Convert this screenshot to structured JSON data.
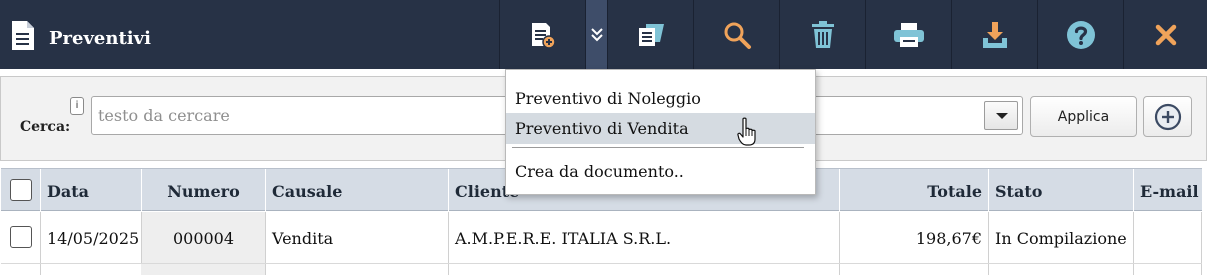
{
  "header": {
    "title": "Preventivi",
    "icon": "document-icon"
  },
  "toolbar": {
    "buttons": [
      {
        "name": "new-quote-button",
        "icon": "new-document-plus-icon"
      },
      {
        "name": "new-options-toggle",
        "icon": "double-chevron-down-icon"
      },
      {
        "name": "copy-button",
        "icon": "copy-documents-icon"
      },
      {
        "name": "search-button",
        "icon": "magnifier-icon"
      },
      {
        "name": "delete-button",
        "icon": "trash-icon"
      },
      {
        "name": "print-button",
        "icon": "printer-icon"
      },
      {
        "name": "download-button",
        "icon": "download-icon"
      },
      {
        "name": "help-button",
        "icon": "question-icon"
      },
      {
        "name": "close-button",
        "icon": "close-x-icon"
      }
    ],
    "icon_color": "#f0a35a",
    "help_icon_color": "#7fc3d6"
  },
  "search": {
    "info_badge": "i",
    "label": "Cerca:",
    "placeholder": "testo da cercare",
    "value": "",
    "apply_label": "Applica"
  },
  "menu": {
    "items": [
      "Preventivo di Noleggio",
      "Preventivo di Vendita",
      "Crea da documento.."
    ],
    "hovered_index": 1
  },
  "table": {
    "columns": [
      "",
      "Data",
      "Numero",
      "Causale",
      "Cliente",
      "Totale",
      "Stato",
      "E-mail"
    ],
    "rows": [
      {
        "checked": false,
        "data": "14/05/2025",
        "numero": "000004",
        "causale": "Vendita",
        "cliente": "A.M.P.E.R.E. ITALIA S.R.L.",
        "totale": "198,67€",
        "stato": "In Compilazione",
        "email": ""
      }
    ]
  },
  "colors": {
    "topbar": "#273246",
    "header_bg": "#d5dce5",
    "menu_hover": "#d5dbe1"
  }
}
